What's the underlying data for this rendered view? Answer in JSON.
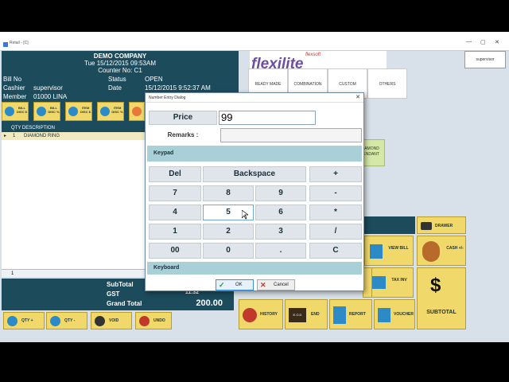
{
  "window": {
    "title": "Retail - [C]",
    "minimize": "—",
    "restore": "▢",
    "close": "✕"
  },
  "header": {
    "company": "DEMO COMPANY",
    "datetime": "Tue 15/12/2015 09:53AM",
    "counter": "Counter No: C1"
  },
  "bill": {
    "bill_no_label": "Bill No",
    "bill_no": "",
    "cashier_label": "Cashier",
    "cashier": "supervisor",
    "member_label": "Member",
    "member": "01000 LINA",
    "status_label": "Status",
    "status": "OPEN",
    "date_label": "Date",
    "date": "15/12/2015 9:52:37 AM"
  },
  "function_buttons": [
    {
      "label": "BILL DISC $",
      "color": "#2c8ac7"
    },
    {
      "label": "BILL DISC %",
      "color": "#2c8ac7"
    },
    {
      "label": "ITEM DISC $",
      "color": "#2c8ac7"
    },
    {
      "label": "ITEM DISC %",
      "color": "#2c8ac7"
    },
    {
      "label": "",
      "color": "#e8773a"
    }
  ],
  "items": {
    "header": "QTY DESCRIPTION",
    "rows": [
      {
        "marker": "▸",
        "qty": "1",
        "description": "DIAMOND RING"
      }
    ],
    "row_index": "1"
  },
  "totals": {
    "subtotal_label": "SubTotal",
    "subtotal": "",
    "gst_label": "GST",
    "gst": "11.32",
    "grand_label": "Grand Total",
    "grand": "200.00"
  },
  "bottom_buttons": [
    {
      "label": "QTY +",
      "color": "#2c8ac7"
    },
    {
      "label": "QTY -",
      "color": "#2c8ac7"
    },
    {
      "label": "VOID",
      "color": "#333333"
    },
    {
      "label": "UNDO",
      "color": "#c0392b"
    }
  ],
  "logo": {
    "small": "flexsoft",
    "main": "flexilite"
  },
  "user_button": "supervisor",
  "categories": [
    "READY MADE",
    "COMBINATION",
    "CUSTOM",
    "OTHERS"
  ],
  "diamond_button": "DIAMOND PENDANT",
  "right_buttons": {
    "drawer": "DRAWER",
    "view_bill": "VIEW BILL",
    "cash": "CASH +/-",
    "tax_inv": "TAX INV",
    "subtotal": "SUBTOTAL",
    "history": "HISTORY",
    "eod": "END",
    "eod_icon": "E.O.D",
    "report": "REPORT",
    "voucher": "VOUCHER"
  },
  "dialog": {
    "title": "Number Entry Dialog",
    "close": "✕",
    "price_label": "Price",
    "price_value": "99",
    "remarks_label": "Remarks :",
    "remarks_value": "",
    "keypad_label": "Keypad",
    "keyboard_label": "Keyboard",
    "keys": [
      "Del",
      "Backspace",
      "+",
      "7",
      "8",
      "9",
      "-",
      "4",
      "5",
      "6",
      "*",
      "1",
      "2",
      "3",
      "/",
      "00",
      "0",
      ".",
      "C"
    ],
    "ok_label": "OK",
    "cancel_label": "Cancel"
  }
}
